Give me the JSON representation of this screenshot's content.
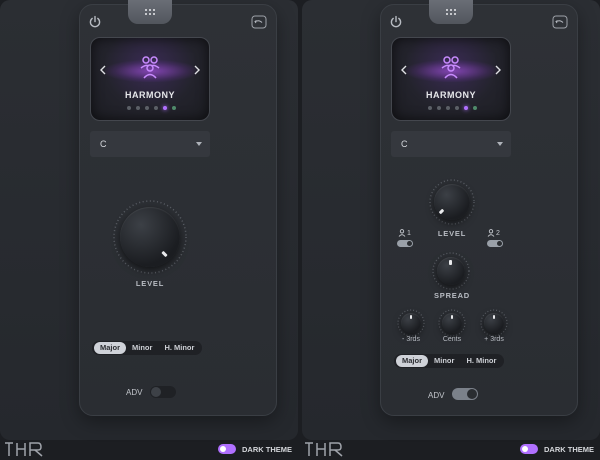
{
  "accent_color": "#b070ff",
  "panels": [
    {
      "mode_title": "HARMONY",
      "key_value": "C",
      "level_label": "LEVEL",
      "scale_options": [
        "Major",
        "Minor",
        "H. Minor"
      ],
      "active_scale": "Major",
      "adv_label": "ADV",
      "adv_enabled": false,
      "mode_dots": 6,
      "active_dot": 5
    },
    {
      "mode_title": "HARMONY",
      "key_value": "C",
      "level_label": "LEVEL",
      "voice1_label": "1",
      "voice2_label": "2",
      "spread_label": "SPREAD",
      "small_knobs": [
        "- 3rds",
        "Cents",
        "+ 3rds"
      ],
      "scale_options": [
        "Major",
        "Minor",
        "H. Minor"
      ],
      "active_scale": "Major",
      "adv_label": "ADV",
      "adv_enabled": true,
      "mode_dots": 6,
      "active_dot": 5
    }
  ],
  "footer": {
    "theme_label": "DARK THEME",
    "logo_icon": "thr-logo"
  }
}
